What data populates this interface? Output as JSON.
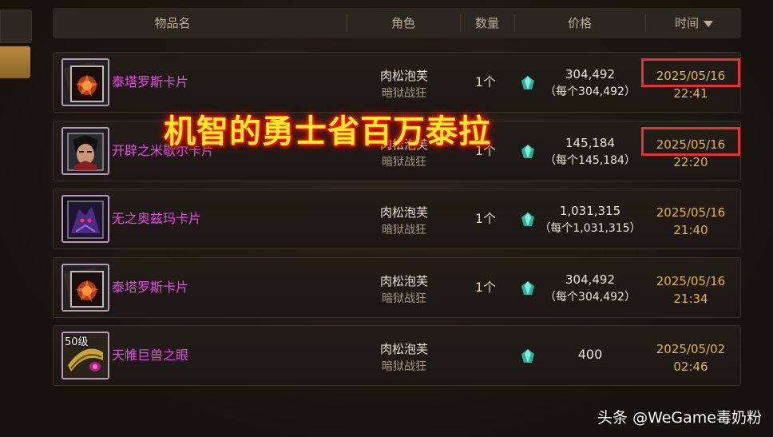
{
  "header": {
    "col_item": "物品名",
    "col_role": "角色",
    "col_qty": "数量",
    "col_price": "价格",
    "col_time": "时间"
  },
  "rows": [
    {
      "level_badge": "",
      "item": "泰塔罗斯卡片",
      "role_name": "肉松泡芙",
      "role_class": "暗狱战狂",
      "qty": "1个",
      "price_total": "304,492",
      "price_each": "（每个304,492）",
      "date": "2025/05/16",
      "time": "22:41",
      "highlighted": true,
      "icon": "card-fiery-crystal-icon"
    },
    {
      "level_badge": "",
      "item": "开辟之米歇尔卡片",
      "role_name": "肉松泡芙",
      "role_class": "暗狱战狂",
      "qty": "1个",
      "price_total": "145,184",
      "price_each": "（每个145,184）",
      "date": "2025/05/16",
      "time": "22:20",
      "highlighted": true,
      "icon": "card-warrior-portrait-icon"
    },
    {
      "level_badge": "",
      "item": "无之奥兹玛卡片",
      "role_name": "肉松泡芙",
      "role_class": "暗狱战狂",
      "qty": "1个",
      "price_total": "1,031,315",
      "price_each": "（每个1,031,315）",
      "date": "2025/05/16",
      "time": "21:40",
      "highlighted": false,
      "icon": "card-dark-demon-icon"
    },
    {
      "level_badge": "",
      "item": "泰塔罗斯卡片",
      "role_name": "肉松泡芙",
      "role_class": "暗狱战狂",
      "qty": "1个",
      "price_total": "304,492",
      "price_each": "（每个304,492）",
      "date": "2025/05/16",
      "time": "21:34",
      "highlighted": false,
      "icon": "card-fiery-crystal-icon"
    },
    {
      "level_badge": "50级",
      "item": "天帷巨兽之眼",
      "role_name": "肉松泡芙",
      "role_class": "暗狱战狂",
      "qty": "",
      "price_total": "400",
      "price_each": "",
      "date": "2025/05/02",
      "time": "02:46",
      "highlighted": false,
      "icon": "beast-eye-item-icon"
    }
  ],
  "overlay_title": "机智的勇士省百万泰拉",
  "watermark": "头条 @WeGame毒奶粉",
  "colors": {
    "item_name": "#e84ae6",
    "time": "#e2b547",
    "highlight": "#e23434",
    "overlay_text": "#ffe82a"
  },
  "icons": {
    "currency": "terra-gem-icon",
    "sort": "caret-down-icon"
  }
}
